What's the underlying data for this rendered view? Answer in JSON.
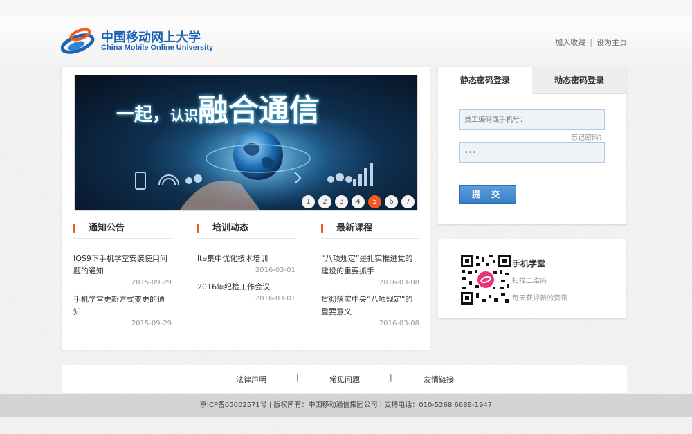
{
  "header": {
    "logo_cn": "中国移动网上大学",
    "logo_en": "China Mobile Online University",
    "add_favorite": "加入收藏",
    "separator": "|",
    "set_home": "设为主页"
  },
  "banner": {
    "text_part1": "一起，",
    "text_part2": "认识",
    "text_part3": "融合通信",
    "pages": [
      "1",
      "2",
      "3",
      "4",
      "5",
      "6",
      "7"
    ],
    "active_page": "5"
  },
  "columns": [
    {
      "title": "通知公告",
      "items": [
        {
          "title": "IOS9下手机学堂安装使用问题的通知",
          "date": "2015-09-29"
        },
        {
          "title": "手机学堂更新方式变更的通知",
          "date": "2015-09-29"
        }
      ]
    },
    {
      "title": "培训动态",
      "items": [
        {
          "title": "lte集中优化技术培训",
          "date": "2016-03-01"
        },
        {
          "title": "2016年纪检工作会议",
          "date": "2016-03-01"
        }
      ]
    },
    {
      "title": "最新课程",
      "items": [
        {
          "title": "“八项规定”是扎实推进党的建设的重要抓手",
          "date": "2016-03-08"
        },
        {
          "title": "贯彻落实中央“八项规定”的重要意义",
          "date": "2016-03-08"
        }
      ]
    }
  ],
  "login": {
    "tab_static": "静态密码登录",
    "tab_dynamic": "动态密码登录",
    "username_placeholder": "员工编码或手机号：",
    "password_value": "•••",
    "forgot": "忘记密码?",
    "submit": "提 交",
    "accent_color": "#3a7fc6"
  },
  "qr": {
    "title": "手机学堂",
    "line1": "扫描二维码",
    "line2": "每天获得新的资讯"
  },
  "footer_links": {
    "legal": "法律声明",
    "faq": "常见问题",
    "links": "友情链接",
    "sep": "|"
  },
  "copyright": "京ICP备05002571号 | 版权所有：中国移动通信集团公司 | 支持电话：010-5268 6688-1947",
  "colors": {
    "brand": "#1c64b4",
    "highlight": "#f25a1f"
  }
}
